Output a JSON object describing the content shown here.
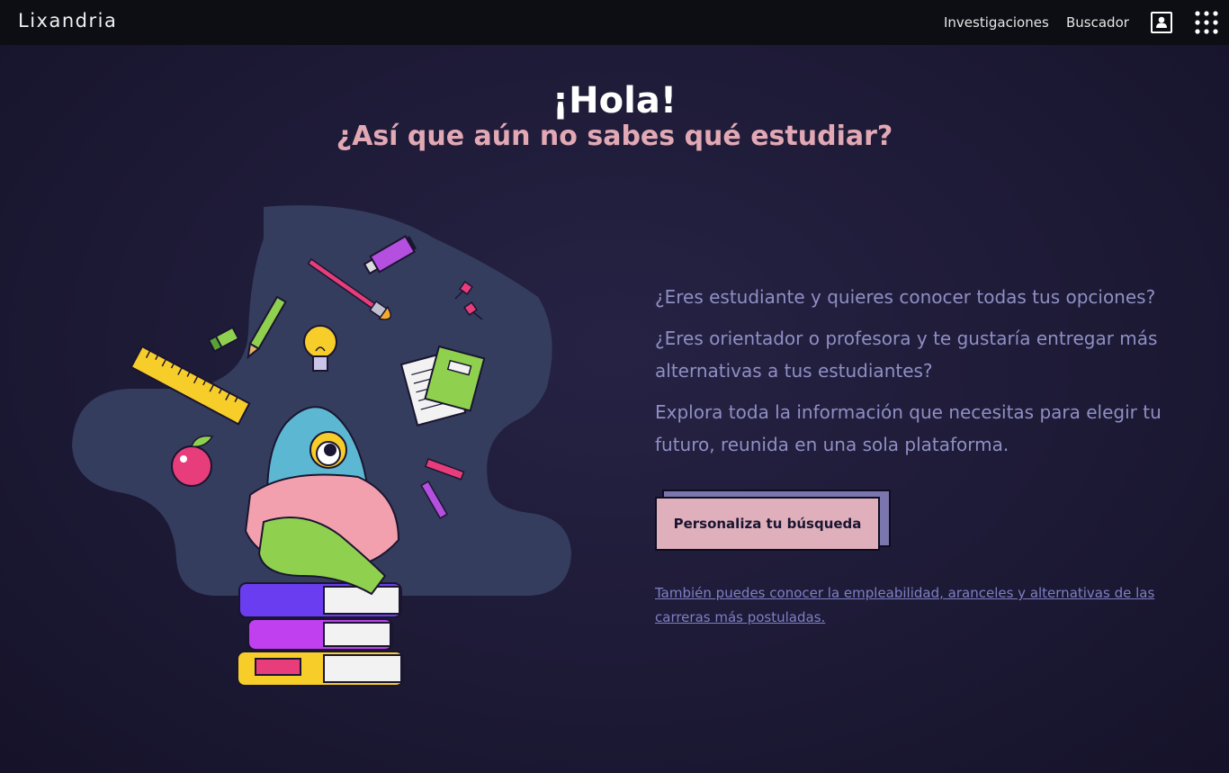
{
  "header": {
    "brand": "Lixandria",
    "nav": [
      {
        "label": "Investigaciones"
      },
      {
        "label": "Buscador"
      }
    ],
    "icons": {
      "account": "user-profile-icon",
      "menu": "app-grid-icon"
    }
  },
  "hero": {
    "greeting": "¡Hola!",
    "subtitle": "¿Así que aún no sabes qué estudiar?"
  },
  "intro": {
    "paragraphs": [
      "¿Eres estudiante y quieres conocer todas tus opciones?",
      "¿Eres orientador o profesora y te gustaría entregar más alternativas a tus estudiantes?",
      "Explora toda la información que necesitas para elegir tu futuro, reunida en una sola plataforma."
    ],
    "cta_label": "Personaliza tu búsqueda",
    "secondary_link": "También puedes conocer la empleabilidad, aranceles y alternativas de las carreras más postuladas."
  },
  "colors": {
    "background": "#1d1a36",
    "topbar": "#0d0d14",
    "accent_pink": "#e2a9b5",
    "text_muted": "#8f8fc4",
    "cta_fill": "#dfb0bc",
    "cta_shadow": "#7b77ae"
  }
}
